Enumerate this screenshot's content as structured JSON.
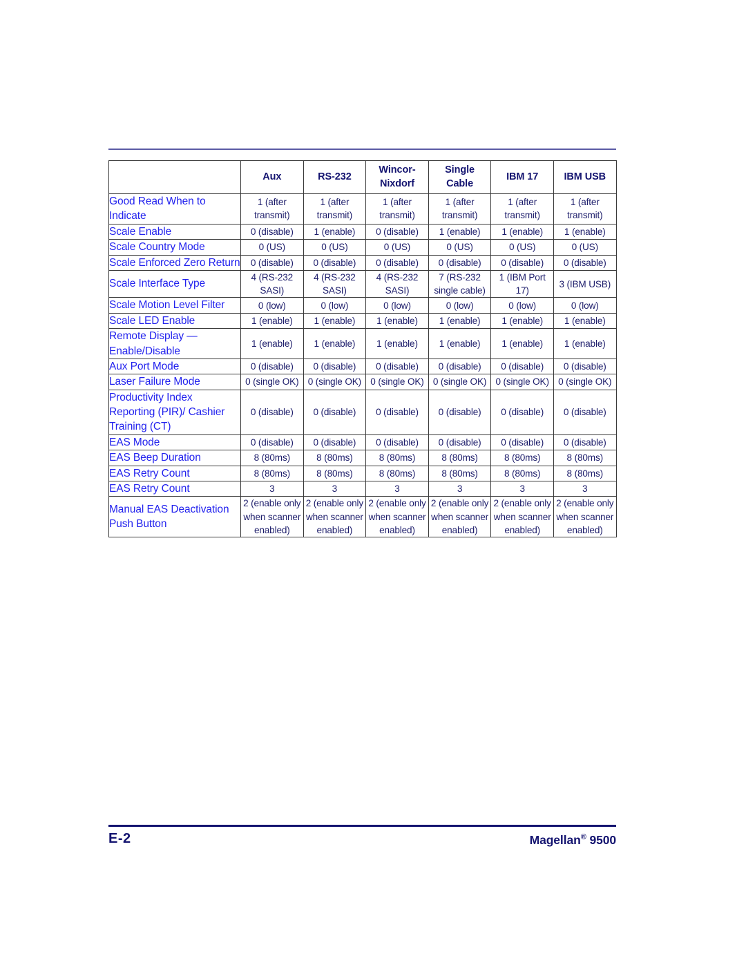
{
  "page": {
    "footer_page_number": "E-2",
    "footer_product_name": "Magellan",
    "footer_product_registered": "®",
    "footer_product_model": "9500",
    "colors": {
      "row_label": "#2222ee",
      "data_text": "#1d1d6b",
      "header_text": "#141470",
      "top_rule": "#5b5ba5",
      "footer_rule": "#141470",
      "table_border": "#3a3a3a"
    }
  },
  "table": {
    "columns": [
      {
        "label": "",
        "key": "label"
      },
      {
        "label": "Aux",
        "key": "aux"
      },
      {
        "label": "RS-232",
        "key": "rs232"
      },
      {
        "label": "Wincor-\nNixdorf",
        "line1": "Wincor-",
        "line2": "Nixdorf",
        "key": "wincor"
      },
      {
        "label": "Single\nCable",
        "line1": "Single",
        "line2": "Cable",
        "key": "single_cable"
      },
      {
        "label": "IBM 17",
        "key": "ibm17"
      },
      {
        "label": "IBM USB",
        "key": "ibm_usb"
      }
    ],
    "rows": [
      {
        "label": "Good Read When to Indicate",
        "values": [
          "1 (after transmit)",
          "1 (after transmit)",
          "1 (after transmit)",
          "1 (after transmit)",
          "1 (after transmit)",
          "1 (after transmit)"
        ]
      },
      {
        "label": "Scale Enable",
        "values": [
          "0 (disable)",
          "1 (enable)",
          "0 (disable)",
          "1 (enable)",
          "1 (enable)",
          "1 (enable)"
        ]
      },
      {
        "label": "Scale Country Mode",
        "values": [
          "0 (US)",
          "0 (US)",
          "0 (US)",
          "0 (US)",
          "0 (US)",
          "0 (US)"
        ]
      },
      {
        "label": "Scale Enforced Zero Return",
        "values": [
          "0 (disable)",
          "0 (disable)",
          "0 (disable)",
          "0 (disable)",
          "0 (disable)",
          "0 (disable)"
        ]
      },
      {
        "label": "Scale Interface Type",
        "values": [
          "4 (RS-232 SASI)",
          "4 (RS-232 SASI)",
          "4 (RS-232 SASI)",
          "7 (RS-232 single cable)",
          "1 (IBM Port 17)",
          "3 (IBM USB)"
        ]
      },
      {
        "label": "Scale Motion Level Filter",
        "values": [
          "0 (low)",
          "0 (low)",
          "0 (low)",
          "0 (low)",
          "0 (low)",
          "0 (low)"
        ]
      },
      {
        "label": "Scale LED Enable",
        "values": [
          "1 (enable)",
          "1 (enable)",
          "1 (enable)",
          "1 (enable)",
          "1 (enable)",
          "1 (enable)"
        ]
      },
      {
        "label": "Remote Display — Enable/Disable",
        "values": [
          "1 (enable)",
          "1 (enable)",
          "1 (enable)",
          "1 (enable)",
          "1 (enable)",
          "1 (enable)"
        ]
      },
      {
        "label": "Aux Port Mode",
        "values": [
          "0 (disable)",
          "0 (disable)",
          "0 (disable)",
          "0 (disable)",
          "0 (disable)",
          "0 (disable)"
        ]
      },
      {
        "label": "Laser Failure Mode",
        "values": [
          "0 (single OK)",
          "0 (single OK)",
          "0 (single OK)",
          "0 (single OK)",
          "0 (single OK)",
          "0 (single OK)"
        ]
      },
      {
        "label": "Productivity Index Reporting (PIR)/ Cashier Training (CT)",
        "values": [
          "0 (disable)",
          "0 (disable)",
          "0 (disable)",
          "0 (disable)",
          "0 (disable)",
          "0 (disable)"
        ]
      },
      {
        "label": "EAS Mode",
        "values": [
          "0 (disable)",
          "0 (disable)",
          "0 (disable)",
          "0 (disable)",
          "0 (disable)",
          "0 (disable)"
        ]
      },
      {
        "label": "EAS Beep Duration",
        "values": [
          "8 (80ms)",
          "8 (80ms)",
          "8 (80ms)",
          "8 (80ms)",
          "8 (80ms)",
          "8 (80ms)"
        ]
      },
      {
        "label": "EAS Retry Count",
        "values": [
          "8 (80ms)",
          "8 (80ms)",
          "8 (80ms)",
          "8 (80ms)",
          "8 (80ms)",
          "8 (80ms)"
        ]
      },
      {
        "label": "EAS Retry Count",
        "values": [
          "3",
          "3",
          "3",
          "3",
          "3",
          "3"
        ]
      },
      {
        "label": "Manual EAS Deactivation Push Button",
        "values": [
          "2 (enable only when scanner enabled)",
          "2 (enable only when scanner enabled)",
          "2 (enable only when scanner enabled)",
          "2 (enable only when scanner enabled)",
          "2 (enable only when scanner enabled)",
          "2 (enable only when scanner enabled)"
        ]
      }
    ]
  }
}
